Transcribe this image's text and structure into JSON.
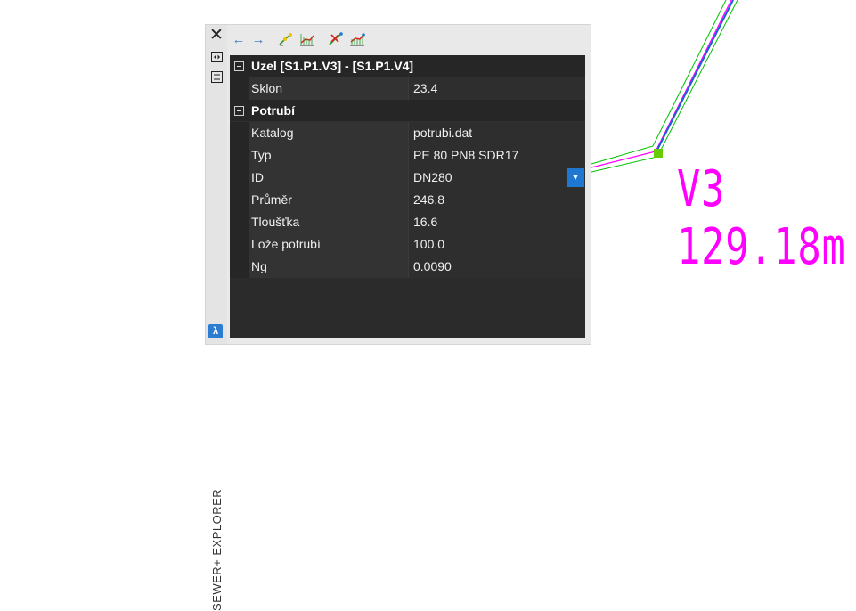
{
  "palette": {
    "side_title": "SEWER+ EXPLORER",
    "close_icon": "close-icon",
    "logo_glyph": "λ"
  },
  "toolbar": {
    "back_icon": "←",
    "forward_icon": "→"
  },
  "grid": {
    "categories": [
      {
        "label": "Uzel [S1.P1.V3] - [S1.P1.V4]",
        "properties": [
          {
            "name": "Sklon",
            "value": "23.4"
          }
        ]
      },
      {
        "label": "Potrubí",
        "properties": [
          {
            "name": "Katalog",
            "value": "potrubi.dat"
          },
          {
            "name": "Typ",
            "value": "PE 80 PN8 SDR17"
          },
          {
            "name": "ID",
            "value": "DN280"
          },
          {
            "name": "Průměr",
            "value": "246.8"
          },
          {
            "name": "Tloušťka",
            "value": "16.6"
          },
          {
            "name": "Lože potrubí",
            "value": "100.0"
          },
          {
            "name": "Ng",
            "value": "0.0090"
          }
        ]
      }
    ]
  },
  "drawing": {
    "label_node": "V3",
    "label_length": "129.18m",
    "label_color": "#ff00ff",
    "pipe_colors": [
      "#00c000",
      "#ff00ff",
      "#1a5fd6"
    ],
    "node_color": "#66cc00"
  }
}
